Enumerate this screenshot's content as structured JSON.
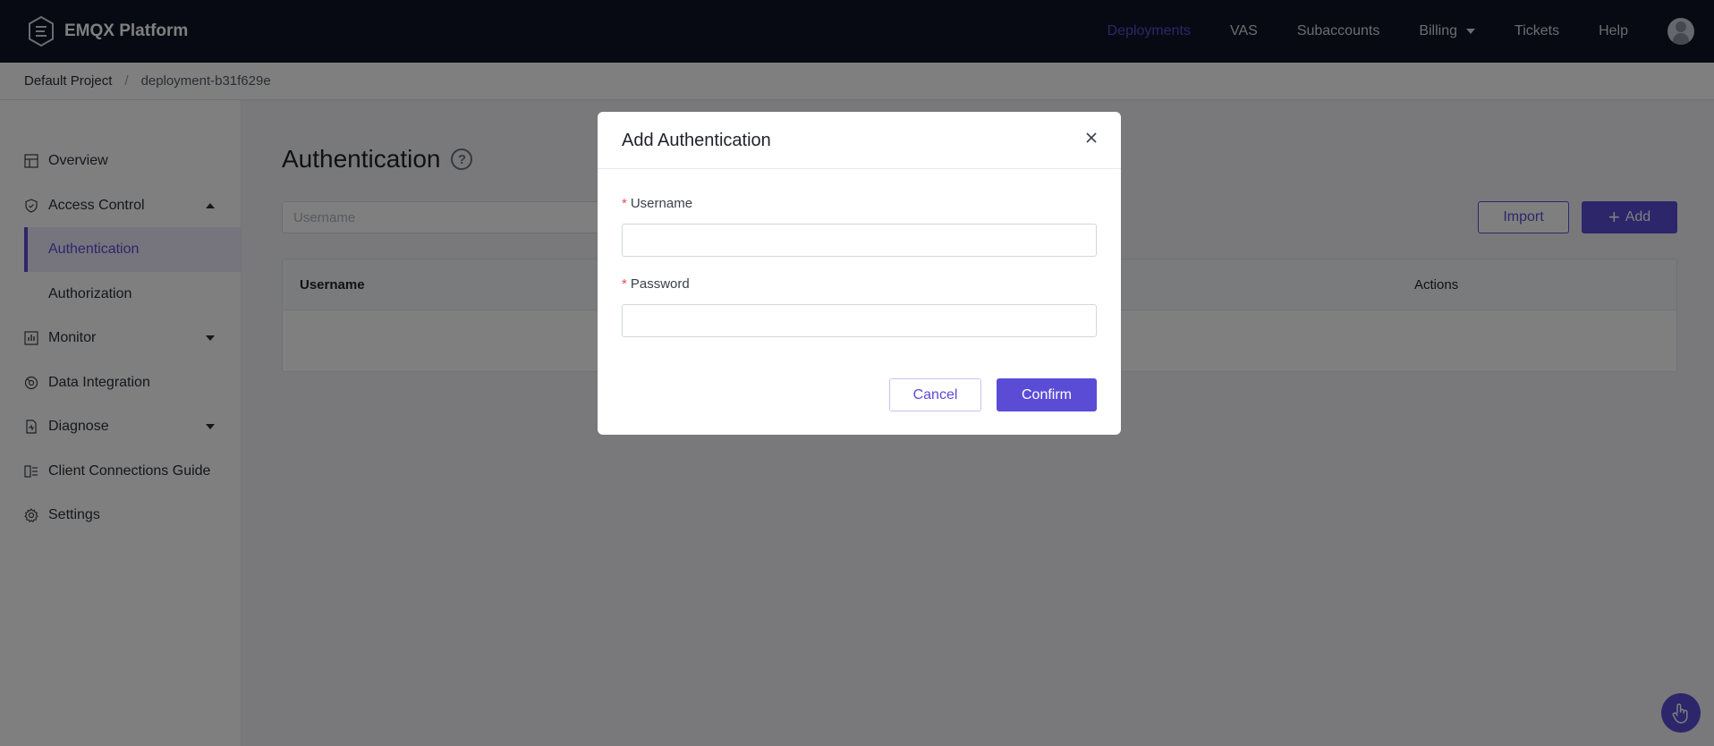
{
  "header": {
    "brand": "EMQX Platform",
    "nav": [
      {
        "label": "Deployments",
        "active": true
      },
      {
        "label": "VAS"
      },
      {
        "label": "Subaccounts"
      },
      {
        "label": "Billing",
        "dropdown": true
      },
      {
        "label": "Tickets"
      },
      {
        "label": "Help"
      }
    ],
    "avatar_icon": "user-avatar-icon"
  },
  "breadcrumb": {
    "project": "Default Project",
    "separator": "/",
    "deployment": "deployment-b31f629e"
  },
  "sidebar": {
    "items": [
      {
        "label": "Overview",
        "icon": "overview-icon"
      },
      {
        "label": "Access Control",
        "icon": "shield-icon",
        "expanded": true
      },
      {
        "label": "Authentication",
        "active": true
      },
      {
        "label": "Authorization"
      },
      {
        "label": "Monitor",
        "icon": "monitor-icon"
      },
      {
        "label": "Data Integration",
        "icon": "integration-icon"
      },
      {
        "label": "Diagnose",
        "icon": "diagnose-icon"
      },
      {
        "label": "Client Connections Guide",
        "icon": "guide-icon"
      },
      {
        "label": "Settings",
        "icon": "gear-icon"
      }
    ]
  },
  "main": {
    "title": "Authentication",
    "search_placeholder": "Username",
    "import_label": "Import",
    "add_label": "Add",
    "table": {
      "columns": [
        "Username",
        "Actions"
      ]
    }
  },
  "modal": {
    "title": "Add Authentication",
    "required_mark": "*",
    "username_label": "Username",
    "username_value": "",
    "password_label": "Password",
    "password_value": "",
    "cancel_label": "Cancel",
    "confirm_label": "Confirm"
  },
  "colors": {
    "accent": "#5b4cd6",
    "topbar": "#0f1424",
    "required": "#e34d59"
  }
}
